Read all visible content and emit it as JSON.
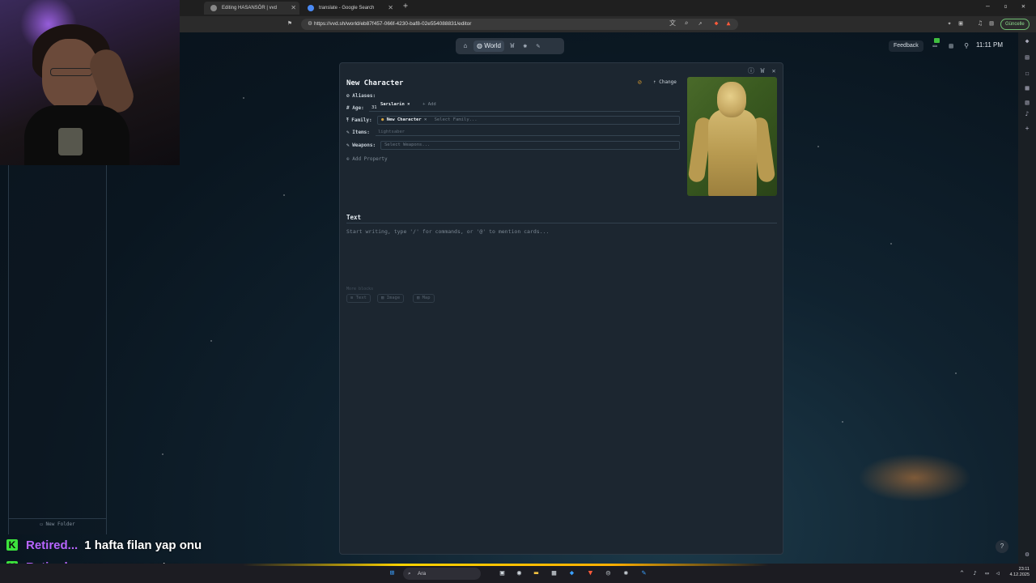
{
  "browser": {
    "tabs": [
      {
        "title": "Editing HASANSÖR | vvd",
        "active": true
      },
      {
        "title": "translate - Google Search",
        "active": false
      }
    ],
    "url": "https://vvd.sh/world/eb87f457-066f-4230-baf8-02e554088831/editor",
    "update_label": "Güncelle"
  },
  "toolbar": {
    "world_label": "World",
    "feedback_label": "Feedback",
    "clock": "11:11 PM"
  },
  "sidebar": {
    "new_folder_label": "New Folder"
  },
  "character": {
    "title": "New Character",
    "change_label": "Change",
    "properties": {
      "aliases_label": "Aliases:",
      "aliases": [
        "Sarılarin"
      ],
      "add_label": "+ Add",
      "age_label": "Age:",
      "age_value": "31",
      "family_label": "Family:",
      "family_chip": "New Character",
      "family_placeholder": "Select Family...",
      "items_label": "Items:",
      "items_value": "lightsaber",
      "weapons_label": "Weapons:",
      "weapons_placeholder": "Select Weapons...",
      "add_property_label": "Add Property"
    },
    "text_section": {
      "title": "Text",
      "placeholder": "Start writing, type '/' for commands, or '@' to mention cards..."
    },
    "more_blocks": {
      "label": "More blocks",
      "buttons": [
        "Text",
        "Image",
        "Map"
      ]
    }
  },
  "chat": [
    {
      "user": "Retired...",
      "message": "1 hafta filan yap onu"
    },
    {
      "user": "Retired...",
      "message": "yazamasın zaten"
    }
  ],
  "taskbar": {
    "search_placeholder": "Ara",
    "time": "23:11",
    "date": "4.12.2025"
  },
  "colors": {
    "panel_bg": "#1c2630",
    "accent_chat_user": "#b865ff",
    "kick_green": "#3ce23c",
    "eye_off_orange": "#e0a030"
  },
  "help_label": "?"
}
